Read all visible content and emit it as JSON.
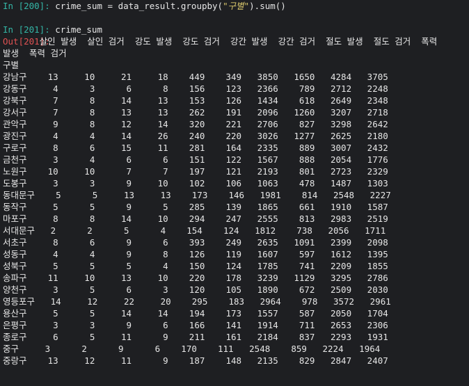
{
  "cells": [
    {
      "prompt": "In [200]:",
      "code_prefix": "crime_sum = data_result.groupby(",
      "code_string": "\"구별\"",
      "code_suffix": ").sum()"
    },
    {
      "prompt": "In [201]:",
      "code": "crime_sum"
    }
  ],
  "output": {
    "prompt": "Out[201]:",
    "header_line1": "       살인 발생  살인 검거  강도 발생  강도 검거  강간 발생  강간 검거  절도 발생  절도 검거  폭력",
    "header_line2": "발생  폭력 검거",
    "index_name": "구별",
    "rows": [
      {
        "gu": "강남구",
        "text": "    13     10     21     18    449    349   3850   1650   4284   3705"
      },
      {
        "gu": "강동구",
        "text": "     4      3      6      8    156    123   2366    789   2712   2248"
      },
      {
        "gu": "강북구",
        "text": "     7      8     14     13    153    126   1434    618   2649   2348"
      },
      {
        "gu": "강서구",
        "text": "     7      8     13     13    262    191   2096   1260   3207   2718"
      },
      {
        "gu": "관악구",
        "text": "     9      8     12     14    320    221   2706    827   3298   2642"
      },
      {
        "gu": "광진구",
        "text": "     4      4     14     26    240    220   3026   1277   2625   2180"
      },
      {
        "gu": "구로구",
        "text": "     8      6     15     11    281    164   2335    889   3007   2432"
      },
      {
        "gu": "금천구",
        "text": "     3      4      6      6    151    122   1567    888   2054   1776"
      },
      {
        "gu": "노원구",
        "text": "    10     10      7      7    197    121   2193    801   2723   2329"
      },
      {
        "gu": "도봉구",
        "text": "     3      3      9     10    102    106   1063    478   1487   1303"
      },
      {
        "gu": "동대문구",
        "text": "    5      5     13     13    173    146   1981    814   2548   2227"
      },
      {
        "gu": "동작구",
        "text": "     5      5      9      5    285    139   1865    661   1910   1587"
      },
      {
        "gu": "마포구",
        "text": "     8      8     14     10    294    247   2555    813   2983   2519"
      },
      {
        "gu": "서대문구",
        "text": "   2      2      5      4    154    124   1812    738   2056   1711"
      },
      {
        "gu": "서초구",
        "text": "     8      6      9      6    393    249   2635   1091   2399   2098"
      },
      {
        "gu": "성동구",
        "text": "     4      4      9      8    126    119   1607    597   1612   1395"
      },
      {
        "gu": "성북구",
        "text": "     5      5      5      4    150    124   1785    741   2209   1855"
      },
      {
        "gu": "송파구",
        "text": "    11     10     13     10    220    178   3239   1129   3295   2786"
      },
      {
        "gu": "양천구",
        "text": "     3      5      6      3    120    105   1890    672   2509   2030"
      },
      {
        "gu": "영등포구",
        "text": "   14     12     22     20    295    183   2964    978   3572   2961"
      },
      {
        "gu": "용산구",
        "text": "     5      5     14     14    194    173   1557    587   2050   1704"
      },
      {
        "gu": "은평구",
        "text": "     3      3      9      6    166    141   1914    711   2653   2306"
      },
      {
        "gu": "종로구",
        "text": "     6      5     11      9    211    161   2184    837   2293   1931"
      },
      {
        "gu": "중구",
        "text": "     3      2      9      6    170    111   2548    859   2224   1964"
      },
      {
        "gu": "중랑구",
        "text": "    13     12     11      9    187    148   2135    829   2847   2407"
      }
    ]
  },
  "colors": {
    "background": "#1e1f22",
    "in_prompt": "#34b7a7",
    "out_prompt": "#e05252",
    "string": "#d6c56b",
    "text": "#e6e6e6"
  }
}
